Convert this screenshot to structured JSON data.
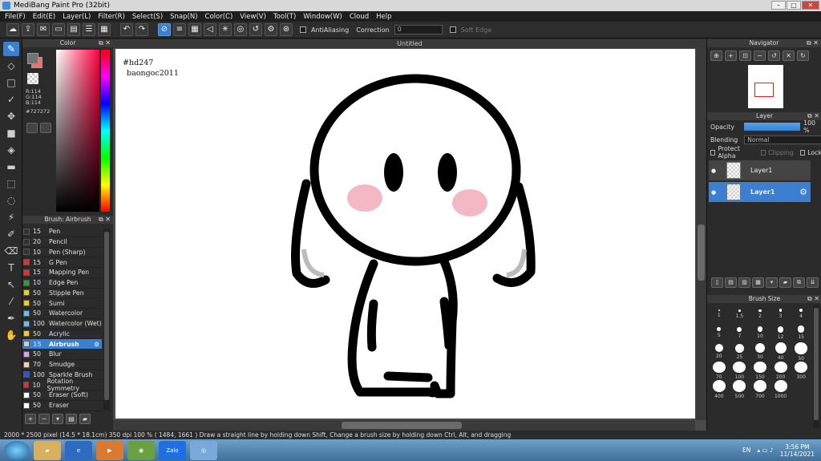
{
  "window": {
    "title": "MediBang Paint Pro (32bit)",
    "min": "–",
    "max": "□",
    "close": "✕"
  },
  "menu": [
    "File(F)",
    "Edit(E)",
    "Layer(L)",
    "Filter(R)",
    "Select(S)",
    "Snap(N)",
    "Color(C)",
    "View(V)",
    "Tool(T)",
    "Window(W)",
    "Cloud",
    "Help"
  ],
  "toolbar": {
    "antialiasing_label": "AntiAliasing",
    "correction_label": "Correction",
    "correction_value": "0",
    "soft_edge_label": "Soft Edge"
  },
  "color_panel": {
    "title": "Color",
    "r": "R:114",
    "g": "G:114",
    "b": "B:114",
    "hex": "#727272",
    "main_color": "#727272",
    "sub_color": "#f07070"
  },
  "brush_panel": {
    "title": "Brush: Airbrush",
    "brushes": [
      {
        "size": "15",
        "name": "Pen",
        "color": "#333333"
      },
      {
        "size": "20",
        "name": "Pencil",
        "color": "#333333"
      },
      {
        "size": "10",
        "name": "Pen (Sharp)",
        "color": "#333333"
      },
      {
        "size": "15",
        "name": "G Pen",
        "color": "#e03030"
      },
      {
        "size": "15",
        "name": "Mapping Pen",
        "color": "#e03030"
      },
      {
        "size": "10",
        "name": "Edge Pen",
        "color": "#30a030"
      },
      {
        "size": "50",
        "name": "Stipple Pen",
        "color": "#e8d020"
      },
      {
        "size": "50",
        "name": "Sumi",
        "color": "#e8d020"
      },
      {
        "size": "50",
        "name": "Watercolor",
        "color": "#60c0f0"
      },
      {
        "size": "100",
        "name": "Watercolor (Wet)",
        "color": "#60c0f0"
      },
      {
        "size": "50",
        "name": "Acrylic",
        "color": "#e8d020"
      },
      {
        "size": "15",
        "name": "Airbrush",
        "color": "#cccccc"
      },
      {
        "size": "50",
        "name": "Blur",
        "color": "#e0a0e0"
      },
      {
        "size": "70",
        "name": "Smudge",
        "color": "#f0d0b0"
      },
      {
        "size": "100",
        "name": "Sparkle Brush",
        "color": "#3050e0"
      },
      {
        "size": "10",
        "name": "Rotation Symmetry",
        "color": "#e03030"
      },
      {
        "size": "50",
        "name": "Eraser (Soft)",
        "color": "#ffffff"
      },
      {
        "size": "50",
        "name": "Eraser",
        "color": "#ffffff"
      }
    ],
    "selected_index": 11
  },
  "document": {
    "tab_title": "Untitled",
    "text_line1": "#hd247",
    "text_line2": "baongoc2011"
  },
  "navigator": {
    "title": "Navigator"
  },
  "layer_panel": {
    "title": "Layer",
    "opacity_label": "Opacity",
    "opacity_value": "100 %",
    "opacity_level": 1.0,
    "blending_label": "Blending",
    "blending_value": "Normal",
    "protect_alpha": "Protect Alpha",
    "clipping": "Clipping",
    "lock": "Lock",
    "layers": [
      {
        "name": "Layer1",
        "selected": false
      },
      {
        "name": "Layer1",
        "selected": true
      }
    ]
  },
  "brush_size_panel": {
    "title": "Brush Size",
    "sizes": [
      "1",
      "1.5",
      "2",
      "3",
      "4",
      "5",
      "7",
      "10",
      "12",
      "15",
      "20",
      "25",
      "30",
      "40",
      "50",
      "70",
      "100",
      "150",
      "200",
      "300",
      "400",
      "500",
      "700",
      "1000"
    ]
  },
  "status": {
    "text": "2000 * 2500 pixel   (14.5 * 18.1cm)   350 dpi   100 %   ( 1484, 1661 )   Draw a straight line by holding down Shift, Change a brush size by holding down Ctrl, Alt, and dragging"
  },
  "taskbar": {
    "lang": "EN",
    "time": "3:56 PM",
    "date": "11/14/2021",
    "zalo": "Zalo"
  }
}
